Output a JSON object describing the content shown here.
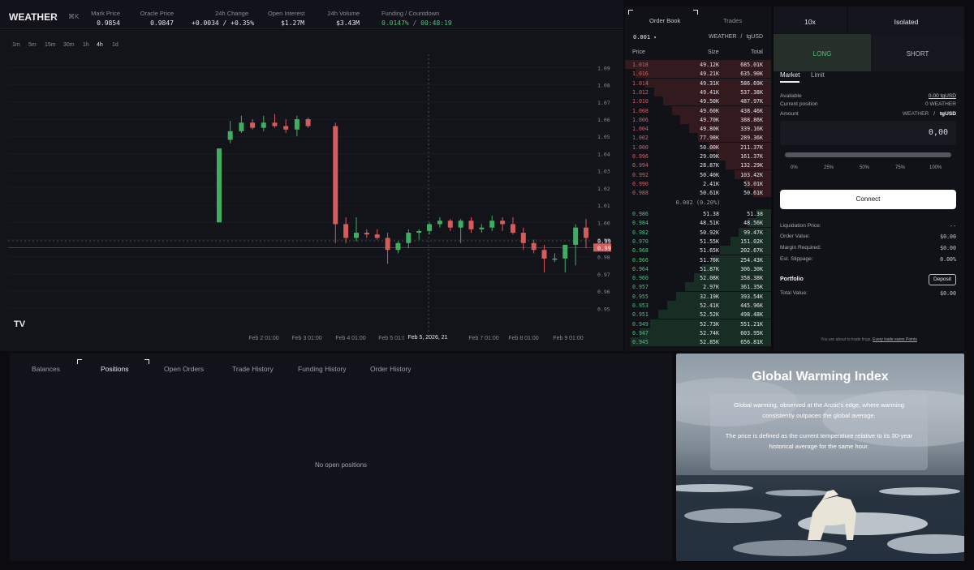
{
  "header": {
    "market": "WEATHER",
    "shortcut": "⌘K",
    "stats": [
      {
        "label": "Mark Price",
        "value": "0.9854",
        "tone": ""
      },
      {
        "label": "Oracle Price",
        "value": "0.9847",
        "tone": ""
      },
      {
        "label": "24h Change",
        "value": "+0.0034 / +0.35%",
        "tone": "g"
      },
      {
        "label": "Open Interest",
        "value": "$1.27M",
        "tone": ""
      },
      {
        "label": "24h Volume",
        "value": "$3.43M",
        "tone": ""
      },
      {
        "label": "Funding / Countdown",
        "value_a": "0.0147%",
        "value_sep": " / ",
        "value_b": "00:48:19"
      }
    ]
  },
  "chart": {
    "timeframes": [
      "1m",
      "5m",
      "15m",
      "30m",
      "1h",
      "4h",
      "1d"
    ],
    "active_timeframe": "4h",
    "logo": "TV",
    "crosshair_label": "Feb 5, 2026, 21",
    "last_price_label": "0.99",
    "crosshair_price": "0.99",
    "colors": {
      "up": "#3fae62",
      "down": "#d55c5c"
    }
  },
  "chart_data": {
    "type": "candlestick",
    "y_ticks": [
      "1.09",
      "1.08",
      "1.07",
      "1.06",
      "1.05",
      "1.04",
      "1.03",
      "1.02",
      "1.01",
      "1.00",
      "0.99",
      "0.98",
      "0.97",
      "0.96",
      "0.95"
    ],
    "x_ticks": [
      "Feb 2 01:00",
      "Feb 3 01:00",
      "Feb 4 01:00",
      "Feb 5 01:0",
      "Feb 7 01:00",
      "Feb 8 01:00",
      "Feb 9 01:00"
    ],
    "ylim": [
      0.945,
      1.093
    ],
    "candles": [
      {
        "o": 1.0,
        "h": 1.043,
        "l": 1.0,
        "c": 1.043
      },
      {
        "o": 1.048,
        "h": 1.059,
        "l": 1.046,
        "c": 1.053
      },
      {
        "o": 1.053,
        "h": 1.062,
        "l": 1.052,
        "c": 1.058
      },
      {
        "o": 1.058,
        "h": 1.06,
        "l": 1.054,
        "c": 1.055
      },
      {
        "o": 1.055,
        "h": 1.062,
        "l": 1.053,
        "c": 1.058
      },
      {
        "o": 1.058,
        "h": 1.063,
        "l": 1.055,
        "c": 1.056
      },
      {
        "o": 1.056,
        "h": 1.06,
        "l": 1.052,
        "c": 1.054
      },
      {
        "o": 1.054,
        "h": 1.062,
        "l": 1.05,
        "c": 1.06
      },
      {
        "o": 1.06,
        "h": 1.061,
        "l": 1.055,
        "c": 1.056
      },
      {
        "o": 1.056,
        "h": 1.058,
        "l": 0.988,
        "c": 0.999
      },
      {
        "o": 0.999,
        "h": 1.003,
        "l": 0.988,
        "c": 0.991
      },
      {
        "o": 0.991,
        "h": 1.003,
        "l": 0.989,
        "c": 0.994
      },
      {
        "o": 0.994,
        "h": 0.996,
        "l": 0.991,
        "c": 0.993
      },
      {
        "o": 0.993,
        "h": 0.996,
        "l": 0.99,
        "c": 0.991
      },
      {
        "o": 0.991,
        "h": 0.994,
        "l": 0.976,
        "c": 0.984
      },
      {
        "o": 0.984,
        "h": 0.989,
        "l": 0.982,
        "c": 0.988
      },
      {
        "o": 0.988,
        "h": 0.996,
        "l": 0.985,
        "c": 0.994
      },
      {
        "o": 0.994,
        "h": 0.996,
        "l": 0.99,
        "c": 0.995
      },
      {
        "o": 0.995,
        "h": 1.0,
        "l": 0.993,
        "c": 0.999
      },
      {
        "o": 0.999,
        "h": 1.003,
        "l": 0.997,
        "c": 1.001
      },
      {
        "o": 1.001,
        "h": 1.002,
        "l": 0.995,
        "c": 0.997
      },
      {
        "o": 0.997,
        "h": 1.002,
        "l": 0.988,
        "c": 1.001
      },
      {
        "o": 1.001,
        "h": 1.003,
        "l": 0.994,
        "c": 0.996
      },
      {
        "o": 0.996,
        "h": 0.999,
        "l": 0.994,
        "c": 0.997
      },
      {
        "o": 0.997,
        "h": 1.004,
        "l": 0.995,
        "c": 1.001
      },
      {
        "o": 1.001,
        "h": 1.003,
        "l": 0.995,
        "c": 0.999
      },
      {
        "o": 0.999,
        "h": 1.003,
        "l": 0.993,
        "c": 0.994
      },
      {
        "o": 0.994,
        "h": 0.997,
        "l": 0.984,
        "c": 0.988
      },
      {
        "o": 0.988,
        "h": 0.99,
        "l": 0.982,
        "c": 0.984
      },
      {
        "o": 0.984,
        "h": 0.987,
        "l": 0.971,
        "c": 0.979
      },
      {
        "o": 0.979,
        "h": 0.982,
        "l": 0.977,
        "c": 0.979
      },
      {
        "o": 0.979,
        "h": 0.987,
        "l": 0.971,
        "c": 0.987
      },
      {
        "o": 0.987,
        "h": 0.999,
        "l": 0.975,
        "c": 0.997
      },
      {
        "o": 0.997,
        "h": 1.002,
        "l": 0.985,
        "c": 0.991
      }
    ]
  },
  "orderbook": {
    "tabs": [
      "Order Book",
      "Trades"
    ],
    "tick_size": "0.001",
    "pair_base": "WEATHER",
    "pair_quote": "tgUSD",
    "columns": [
      "Price",
      "Size",
      "Total"
    ],
    "asks": [
      {
        "price": "1.018",
        "size": "49.12K",
        "total": "685.01K",
        "depth": 1.0
      },
      {
        "price": "1.016",
        "size": "49.21K",
        "total": "635.90K",
        "depth": 0.93
      },
      {
        "price": "1.014",
        "size": "49.31K",
        "total": "586.69K",
        "depth": 0.86
      },
      {
        "price": "1.012",
        "size": "49.41K",
        "total": "537.38K",
        "depth": 0.8
      },
      {
        "price": "1.010",
        "size": "49.50K",
        "total": "487.97K",
        "depth": 0.74
      },
      {
        "price": "1.008",
        "size": "49.60K",
        "total": "438.46K",
        "depth": 0.68
      },
      {
        "price": "1.006",
        "size": "49.70K",
        "total": "388.86K",
        "depth": 0.62
      },
      {
        "price": "1.004",
        "size": "49.80K",
        "total": "339.16K",
        "depth": 0.56
      },
      {
        "price": "1.002",
        "size": "77.98K",
        "total": "289.36K",
        "depth": 0.5
      },
      {
        "price": "1.000",
        "size": "50.00K",
        "total": "211.37K",
        "depth": 0.43
      },
      {
        "price": "0.996",
        "size": "29.09K",
        "total": "161.37K",
        "depth": 0.37
      },
      {
        "price": "0.994",
        "size": "28.87K",
        "total": "132.29K",
        "depth": 0.31
      },
      {
        "price": "0.992",
        "size": "50.40K",
        "total": "103.42K",
        "depth": 0.25
      },
      {
        "price": "0.990",
        "size": "2.41K",
        "total": "53.01K",
        "depth": 0.18
      },
      {
        "price": "0.988",
        "size": "50.61K",
        "total": "50.61K",
        "depth": 0.12
      }
    ],
    "spread": "0.002 (0.20%)",
    "bids": [
      {
        "price": "0.986",
        "size": "51.38",
        "total": "51.38",
        "depth": 0.1
      },
      {
        "price": "0.984",
        "size": "48.51K",
        "total": "48.56K",
        "depth": 0.16
      },
      {
        "price": "0.982",
        "size": "50.92K",
        "total": "99.47K",
        "depth": 0.22
      },
      {
        "price": "0.970",
        "size": "51.55K",
        "total": "151.02K",
        "depth": 0.28
      },
      {
        "price": "0.968",
        "size": "51.65K",
        "total": "202.67K",
        "depth": 0.35
      },
      {
        "price": "0.966",
        "size": "51.76K",
        "total": "254.43K",
        "depth": 0.41
      },
      {
        "price": "0.964",
        "size": "51.87K",
        "total": "306.30K",
        "depth": 0.47
      },
      {
        "price": "0.960",
        "size": "52.08K",
        "total": "358.38K",
        "depth": 0.53
      },
      {
        "price": "0.957",
        "size": "2.97K",
        "total": "361.35K",
        "depth": 0.59
      },
      {
        "price": "0.955",
        "size": "32.19K",
        "total": "393.54K",
        "depth": 0.65
      },
      {
        "price": "0.953",
        "size": "52.41K",
        "total": "445.96K",
        "depth": 0.71
      },
      {
        "price": "0.951",
        "size": "52.52K",
        "total": "498.48K",
        "depth": 0.77
      },
      {
        "price": "0.949",
        "size": "52.73K",
        "total": "551.21K",
        "depth": 0.83
      },
      {
        "price": "0.947",
        "size": "52.74K",
        "total": "603.95K",
        "depth": 0.9
      },
      {
        "price": "0.945",
        "size": "52.85K",
        "total": "656.81K",
        "depth": 0.96
      }
    ]
  },
  "trade": {
    "leverage": "10x",
    "margin_mode": "Isolated",
    "long_label": "LONG",
    "short_label": "SHORT",
    "order_types": [
      "Market",
      "Limit"
    ],
    "available_label": "Available",
    "available_value": "0.00 tgUSD",
    "position_label": "Current position",
    "position_value": "0 WEATHER",
    "amount_label": "Amount",
    "amount_base": "WEATHER",
    "amount_sep": "/",
    "amount_quote": "tgUSD",
    "amount_value": "0,00",
    "slider_ticks": [
      "0%",
      "25%",
      "50%",
      "75%",
      "100%"
    ],
    "connect_label": "Connect",
    "details": [
      {
        "label": "Liquidation Price:",
        "value": "--"
      },
      {
        "label": "Order Value:",
        "value": "$0.00"
      },
      {
        "label": "Margin Required:",
        "value": "$0.00"
      },
      {
        "label": "Est. Slippage:",
        "value": "0.00%"
      }
    ],
    "portfolio_label": "Portfolio",
    "deposit_label": "Deposit",
    "total_value_label": "Total Value:",
    "total_value": "$0.00",
    "footer_note": "You are about to trade tings.",
    "footer_link": "Every trade earns Points"
  },
  "bottom": {
    "tabs": [
      "Balances",
      "Positions",
      "Open Orders",
      "Trade History",
      "Funding History",
      "Order History"
    ],
    "active_tab": "Positions",
    "empty_text": "No open positions"
  },
  "info": {
    "title": "Global Warming Index",
    "p1": "Global warming, observed at the Arctic's edge, where warming consistently outpaces the global average.",
    "p2": "The price is defined as the current temperature relative to its 30-year historical average for the same hour."
  }
}
